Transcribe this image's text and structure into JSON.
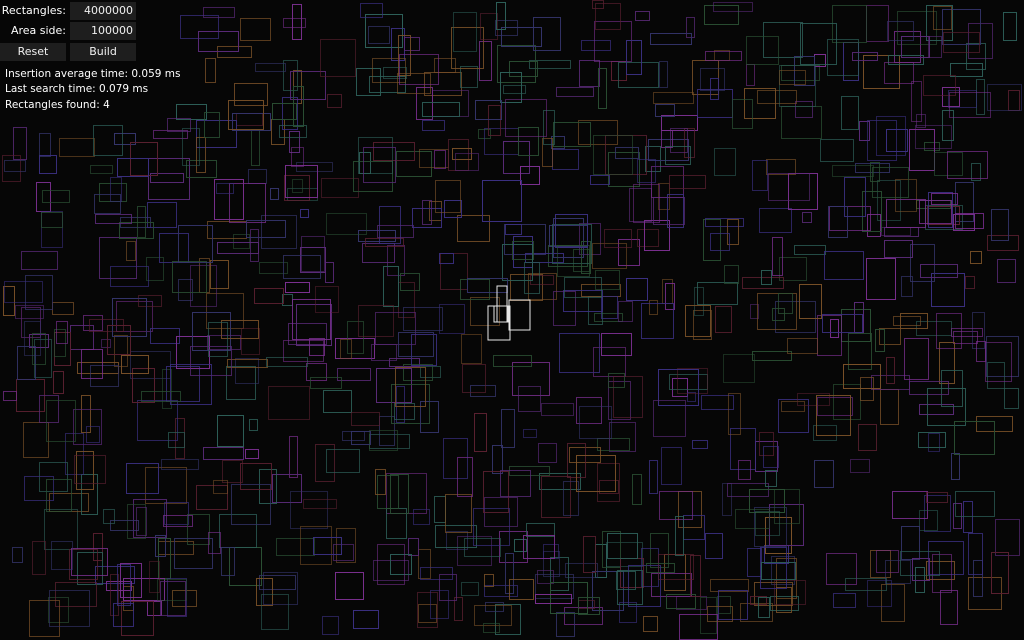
{
  "controls": {
    "rectangles_label": "Rectangles:",
    "rectangles_value": "4000000",
    "area_side_label": "Area side:",
    "area_side_value": "100000",
    "reset_label": "Reset",
    "build_label": "Build"
  },
  "stats": {
    "insertion": "Insertion average time: 0.059 ms",
    "last_search": "Last search time: 0.079 ms",
    "found": "Rectangles found: 4"
  },
  "colors": {
    "background": "#060606",
    "highlight": "#e8e8e8",
    "palette": [
      "#5a2a78",
      "#7a2f8f",
      "#2d5f58",
      "#3a2f80",
      "#7a5128",
      "#2a4f33",
      "#5a2030",
      "#34346a"
    ]
  }
}
